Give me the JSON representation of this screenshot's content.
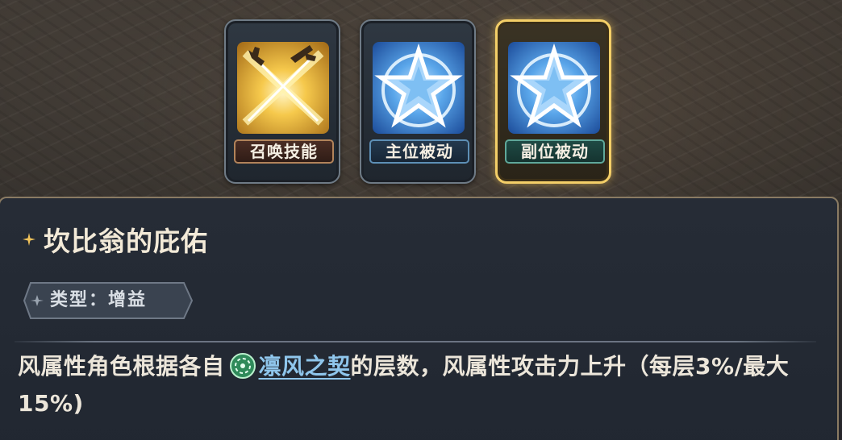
{
  "skills": [
    {
      "label": "召唤技能",
      "icon": "crossed-swords-icon",
      "accent": "#b2835a",
      "selected": false
    },
    {
      "label": "主位被动",
      "icon": "star-emblem-icon",
      "accent": "#5d8fb6",
      "selected": false
    },
    {
      "label": "副位被动",
      "icon": "star-emblem-icon",
      "accent": "#5fa89a",
      "selected": true
    }
  ],
  "detail": {
    "title": "坎比翁的庇佑",
    "type_label": "类型：增益",
    "desc_before": "风属性角色根据各自",
    "link_icon": "wind-element-icon",
    "link_text": "凛风之契",
    "desc_after": "的层数，风属性攻击力上升（每层3%/最大15%)"
  },
  "colors": {
    "selected_border": "#f4cf68",
    "link": "#8fc6ec",
    "title": "#f3ead8"
  }
}
